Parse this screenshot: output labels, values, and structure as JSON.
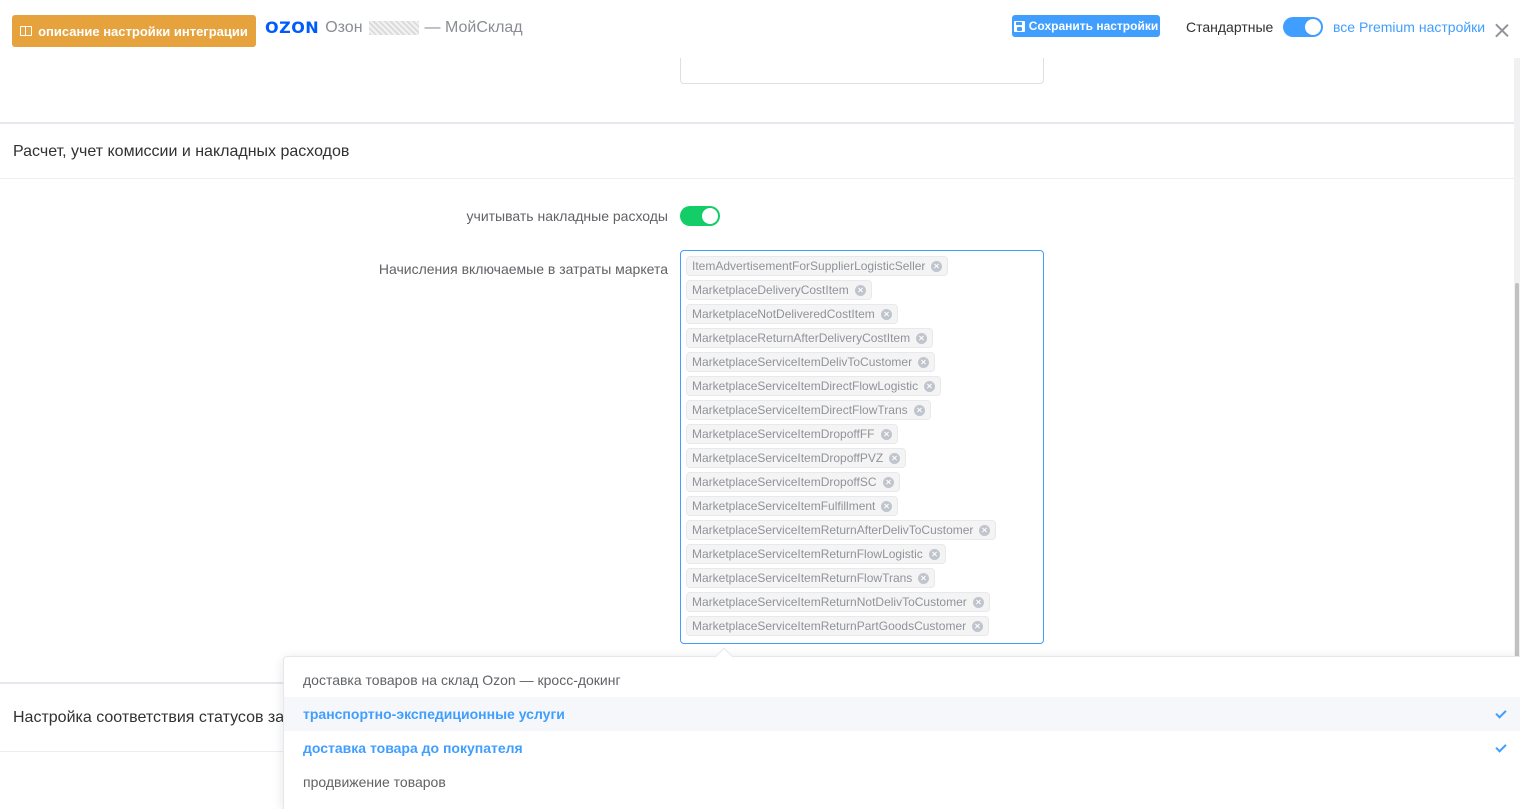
{
  "header": {
    "doc_button": "описание настройки интеграции",
    "brand_logo": "OZON",
    "brand_name": "Озон",
    "brand_suffix": "— МойСклад",
    "save_button": "Сохранить настройки",
    "standard_label": "Стандартные",
    "premium_toggle_on": true,
    "premium_link": "все Premium настройки"
  },
  "section_costs": {
    "title": "Расчет, учет комиссии и накладных расходов",
    "overhead_label": "учитывать накладные расходы",
    "overhead_enabled": true,
    "charges_label": "Начисления включаемые в затраты маркета",
    "tags": [
      "ItemAdvertisementForSupplierLogisticSeller",
      "MarketplaceDeliveryCostItem",
      "MarketplaceNotDeliveredCostItem",
      "MarketplaceReturnAfterDeliveryCostItem",
      "MarketplaceServiceItemDelivToCustomer",
      "MarketplaceServiceItemDirectFlowLogistic",
      "MarketplaceServiceItemDirectFlowTrans",
      "MarketplaceServiceItemDropoffFF",
      "MarketplaceServiceItemDropoffPVZ",
      "MarketplaceServiceItemDropoffSC",
      "MarketplaceServiceItemFulfillment",
      "MarketplaceServiceItemReturnAfterDelivToCustomer",
      "MarketplaceServiceItemReturnFlowLogistic",
      "MarketplaceServiceItemReturnFlowTrans",
      "MarketplaceServiceItemReturnNotDelivToCustomer",
      "MarketplaceServiceItemReturnPartGoodsCustomer"
    ]
  },
  "section_statuses": {
    "title": "Настройка соответствия статусов заказов"
  },
  "dropdown": {
    "options": [
      {
        "label": "доставка товаров на склад Ozon — кросс-докинг",
        "selected": false
      },
      {
        "label": "транспортно-экспедиционные услуги",
        "selected": true
      },
      {
        "label": "доставка товара до покупателя",
        "selected": true
      },
      {
        "label": "продвижение товаров",
        "selected": false
      }
    ]
  },
  "colors": {
    "accent": "#409eff",
    "warning": "#e6a23c",
    "success": "#13ce66"
  }
}
